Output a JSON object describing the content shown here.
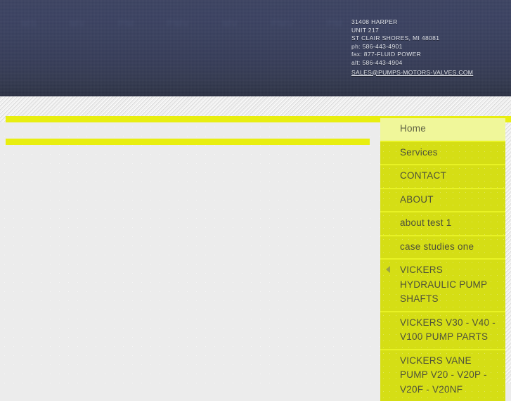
{
  "header": {
    "watermark_text": [
      "MS",
      "MV",
      "PM",
      "PMV",
      "MV",
      "PMV",
      "PM",
      "MV"
    ],
    "contact": {
      "street": "31408 HARPER",
      "unit": "UNIT 217",
      "city_state_zip": "ST CLAIR SHORES, MI 48081",
      "phone": "ph: 586-443-4901",
      "fax": "fax: 877-FLUID POWER",
      "alt": "alt: 586-443-4904",
      "email": "SALES@PUMPS-MOTORS-VALVES.COM"
    }
  },
  "colors": {
    "header_top": "#3b4260",
    "header_bottom": "#2b3043",
    "accent_yellow": "#e8ee10",
    "menu_dark": "#d5de15",
    "menu_light": "#f0f79a",
    "menu_separator": "#e8f224",
    "content_bg": "#ececec"
  },
  "menu": {
    "items": [
      {
        "label": "Home",
        "state": "active",
        "arrow": false
      },
      {
        "label": "Services",
        "state": "normal",
        "arrow": false
      },
      {
        "label": "CONTACT",
        "state": "normal",
        "arrow": false
      },
      {
        "label": "ABOUT",
        "state": "normal",
        "arrow": false
      },
      {
        "label": "about test 1",
        "state": "normal",
        "arrow": false
      },
      {
        "label": "case studies one",
        "state": "normal",
        "arrow": false
      },
      {
        "label": "VICKERS HYDRAULIC PUMP SHAFTS",
        "state": "normal",
        "arrow": true
      },
      {
        "label": "VICKERS V30 - V40 - V100 PUMP PARTS",
        "state": "normal",
        "arrow": false
      },
      {
        "label": "VICKERS VANE PUMP V20 - V20P - V20F - V20NF",
        "state": "normal",
        "arrow": false
      }
    ]
  }
}
